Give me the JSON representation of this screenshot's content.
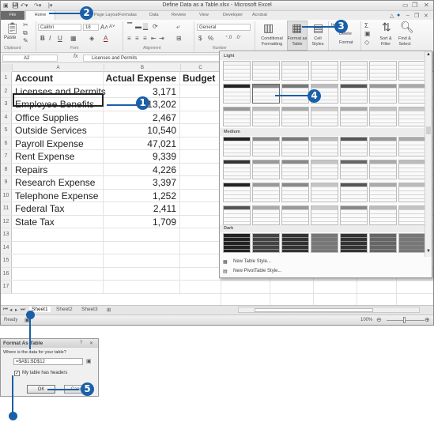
{
  "window": {
    "title": "Define Data as a Table.xlsx - Microsoft Excel",
    "controls": [
      "minimize",
      "restore",
      "close"
    ]
  },
  "qat": {
    "icons": [
      "excel-icon",
      "save-icon",
      "undo-icon",
      "redo-icon",
      "customize-icon"
    ]
  },
  "tabs": [
    {
      "label": "File"
    },
    {
      "label": "Home",
      "active": true
    },
    {
      "label": "Insert"
    },
    {
      "label": "Page Layout"
    },
    {
      "label": "Formulas"
    },
    {
      "label": "Data"
    },
    {
      "label": "Review"
    },
    {
      "label": "View"
    },
    {
      "label": "Developer"
    },
    {
      "label": "Acrobat"
    }
  ],
  "ribbon": {
    "clipboard": {
      "label": "Clipboard",
      "paste": "Paste"
    },
    "font": {
      "label": "Font",
      "name": "Calibri",
      "size": "18",
      "bold": "B",
      "italic": "I",
      "underline": "U"
    },
    "alignment": {
      "label": "Alignment"
    },
    "number": {
      "label": "Number",
      "format": "General",
      "currency": "$",
      "percent": "%"
    },
    "styles": {
      "conditional": "Conditional Formatting",
      "format_table": "Format as Table",
      "cell_styles": "Cell Styles"
    },
    "cells": {
      "insert": "Insert",
      "delete": "Delete",
      "format": "Format"
    },
    "editing": {
      "sum": "Σ",
      "sort": "Sort & Filter",
      "find": "Find & Select"
    }
  },
  "formula_bar": {
    "name_box": "A2",
    "fx": "fx",
    "value": "Licenses and Permits"
  },
  "columns": [
    "A",
    "B",
    "C"
  ],
  "sheet": {
    "rows": [
      {
        "n": "1",
        "a": "Account",
        "b": "Actual Expense",
        "c": "Budget"
      },
      {
        "n": "2",
        "a": "Licenses and Permits",
        "b": "3,171",
        "c": ""
      },
      {
        "n": "3",
        "a": "Employee Benefits",
        "b": "13,202",
        "c": ""
      },
      {
        "n": "4",
        "a": "Office Supplies",
        "b": "2,467",
        "c": ""
      },
      {
        "n": "5",
        "a": "Outside Services",
        "b": "10,540",
        "c": ""
      },
      {
        "n": "6",
        "a": "Payroll Expense",
        "b": "47,021",
        "c": ""
      },
      {
        "n": "7",
        "a": "Rent Expense",
        "b": "9,339",
        "c": ""
      },
      {
        "n": "8",
        "a": "Repairs",
        "b": "4,226",
        "c": ""
      },
      {
        "n": "9",
        "a": "Research Expense",
        "b": "3,397",
        "c": ""
      },
      {
        "n": "10",
        "a": "Telephone Expense",
        "b": "1,252",
        "c": ""
      },
      {
        "n": "11",
        "a": "Federal Tax",
        "b": "2,411",
        "c": ""
      },
      {
        "n": "12",
        "a": "State Tax",
        "b": "1,709",
        "c": ""
      },
      {
        "n": "13",
        "a": "",
        "b": "",
        "c": ""
      },
      {
        "n": "14",
        "a": "",
        "b": "",
        "c": ""
      },
      {
        "n": "15",
        "a": "",
        "b": "",
        "c": ""
      },
      {
        "n": "16",
        "a": "",
        "b": "",
        "c": ""
      },
      {
        "n": "17",
        "a": "",
        "b": "",
        "c": ""
      }
    ]
  },
  "sheet_tabs": [
    "Sheet1",
    "Sheet2",
    "Sheet3"
  ],
  "status": {
    "ready": "Ready",
    "zoom": "100%"
  },
  "gallery": {
    "sections": [
      "Light",
      "Medium",
      "Dark"
    ],
    "new_table_style": "New Table Style...",
    "new_pivot_style": "New PivotTable Style..."
  },
  "dialog": {
    "title": "Format As Table",
    "prompt": "Where is the data for your table?",
    "range": "=$A$1:$D$12",
    "headers_label": "My table has headers",
    "headers_checked": true,
    "ok": "OK",
    "cancel": "Cancel"
  },
  "callouts": [
    "1",
    "2",
    "3",
    "4",
    "5"
  ],
  "colors": {
    "callout": "#1a5fa8",
    "file_tab": "#6b6b6b"
  }
}
